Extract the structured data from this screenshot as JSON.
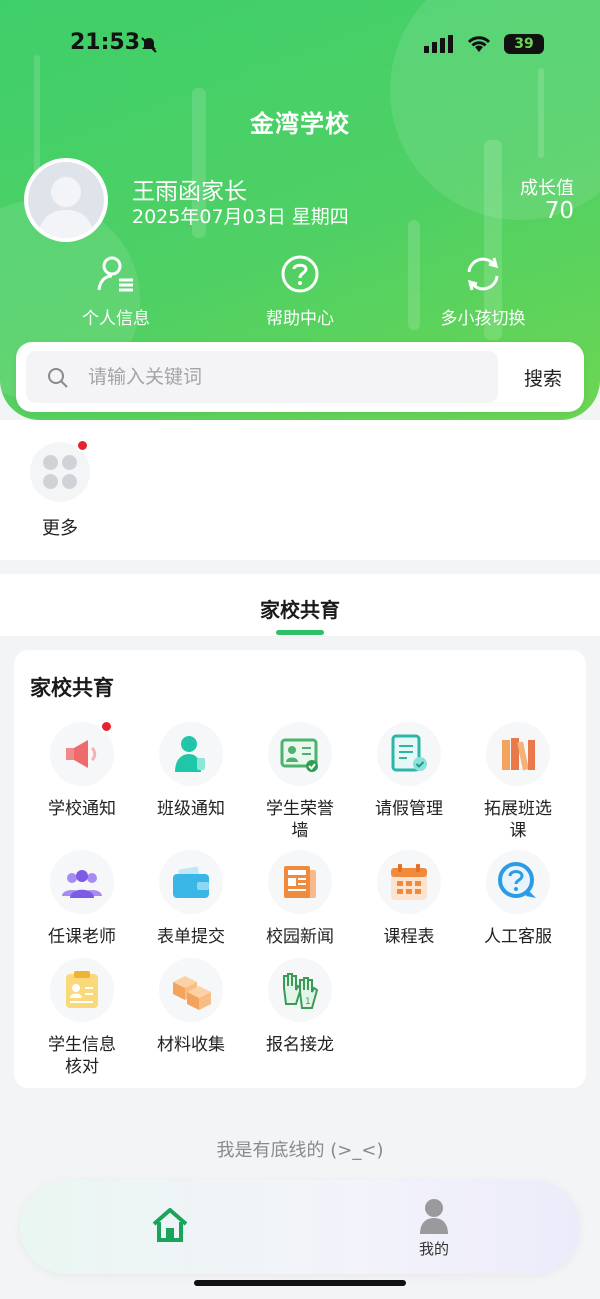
{
  "status_bar": {
    "time": "21:53",
    "battery": "39"
  },
  "header": {
    "school_name": "金湾学校",
    "user_name": "王雨函家长",
    "date": "2025年07月03日 星期四",
    "growth_label": "成长值",
    "growth_value": "70"
  },
  "quick_actions": [
    {
      "label": "个人信息",
      "icon": "person-list-icon"
    },
    {
      "label": "帮助中心",
      "icon": "question-circle-icon"
    },
    {
      "label": "多小孩切换",
      "icon": "refresh-switch-icon"
    }
  ],
  "search": {
    "placeholder": "请输入关键词",
    "button": "搜索"
  },
  "more": {
    "label": "更多"
  },
  "tab": {
    "title": "家校共育"
  },
  "section": {
    "title": "家校共育",
    "items": [
      {
        "label": "学校通知",
        "icon": "megaphone-icon",
        "badge": true
      },
      {
        "label": "班级通知",
        "icon": "person-phone-icon"
      },
      {
        "label": "学生荣誉墙",
        "icon": "id-card-check-icon"
      },
      {
        "label": "请假管理",
        "icon": "document-check-icon"
      },
      {
        "label": "拓展班选课",
        "icon": "books-icon"
      },
      {
        "label": "任课老师",
        "icon": "group-people-icon"
      },
      {
        "label": "表单提交",
        "icon": "wallet-icon"
      },
      {
        "label": "校园新闻",
        "icon": "newspaper-icon"
      },
      {
        "label": "课程表",
        "icon": "calendar-icon"
      },
      {
        "label": "人工客服",
        "icon": "help-chat-icon"
      },
      {
        "label": "学生信息核对",
        "icon": "clipboard-check-icon"
      },
      {
        "label": "材料收集",
        "icon": "boxes-icon"
      },
      {
        "label": "报名接龙",
        "icon": "raised-hands-icon"
      }
    ]
  },
  "footer": {
    "text": "我是有底线的 (>_<)"
  },
  "bottom_nav": {
    "home_icon": "home-icon",
    "mine_label": "我的"
  },
  "colors": {
    "header_green": "#4fd064",
    "accent_green": "#2fbf67",
    "badge_red": "#e5232e"
  }
}
